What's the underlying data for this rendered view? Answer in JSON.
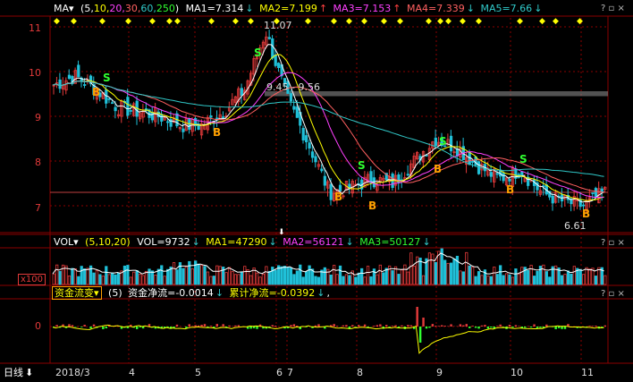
{
  "colors": {
    "up": "#e23a3a",
    "down": "#20c0d8",
    "ma1": "#ffffff",
    "ma2": "#ffff00",
    "ma3": "#ff40ff",
    "ma4": "#ff6060",
    "ma5": "#30c8c8",
    "grid": "#8b0000",
    "label_white": "#ffffff",
    "label_yellow": "#ffff00",
    "label_magenta": "#ff40ff",
    "label_green": "#30ff30",
    "label_cyan": "#30c8c8",
    "accent_orange": "#ffa000"
  },
  "header": {
    "indicator": "MA",
    "params_open": "(",
    "p1": "5,",
    "p2": "10,",
    "p3": "20,",
    "p4": "30,",
    "p5": "60,",
    "p6": "250",
    "params_close": ")",
    "ma1": "MA1=7.314",
    "ma1_arrow": "↓",
    "ma2": "MA2=7.199",
    "ma2_arrow": "↑",
    "ma3": "MA3=7.153",
    "ma3_arrow": "↑",
    "ma4": "MA4=7.339",
    "ma4_arrow": "↓",
    "ma5": "MA5=7.66",
    "ma5_arrow": "↓",
    "icons": "?",
    "close": "×"
  },
  "price_axis": {
    "labels": [
      "11",
      "10",
      "9",
      "8",
      "7"
    ],
    "min": 6.4,
    "max": 11.2
  },
  "annotations": {
    "high": "11.07",
    "low": "6.61",
    "range": "9.45 - 9.56",
    "buy": "B",
    "sell": "S"
  },
  "vol_header": {
    "indicator": "VOL",
    "params": "(5,10,20)",
    "vol": "VOL=9732",
    "vol_arrow": "↓",
    "ma1": "MA1=47290",
    "ma1_arrow": "↓",
    "ma2": "MA2=56121",
    "ma2_arrow": "↓",
    "ma3": "MA3=50127",
    "ma3_arrow": "↓",
    "unit": "x100"
  },
  "flow_header": {
    "indicator": "资金流变",
    "params": "(5)",
    "net": "资金净流=-0.0014",
    "net_arrow": "↓",
    "cum": "累计净流=-0.0392",
    "cum_arrow": "↓",
    "tail": ",",
    "zero": "0"
  },
  "footer": {
    "period": "日线",
    "period_arrow": "⬇",
    "months": [
      "2018/3",
      "4",
      "5",
      "6",
      "7",
      "8",
      "9",
      "10",
      "11"
    ]
  },
  "chart_data": {
    "type": "candlestick",
    "series_label": "price",
    "ylim": [
      6.4,
      11.2
    ],
    "close_points": [
      [
        "2018/3",
        9.7
      ],
      [
        "",
        9.9
      ],
      [
        "",
        9.6
      ],
      [
        "",
        9.2
      ],
      [
        "4",
        9.1
      ],
      [
        "",
        9.0
      ],
      [
        "",
        8.8
      ],
      [
        "5",
        8.8
      ],
      [
        "",
        9.1
      ],
      [
        "",
        9.6
      ],
      [
        "",
        10.9
      ],
      [
        "6",
        9.4
      ],
      [
        "",
        8.4
      ],
      [
        "7",
        7.3
      ],
      [
        "",
        7.4
      ],
      [
        "",
        7.6
      ],
      [
        "8",
        7.5
      ],
      [
        "",
        8.0
      ],
      [
        "",
        8.5
      ],
      [
        "9",
        8.3
      ],
      [
        "",
        7.9
      ],
      [
        "",
        7.6
      ],
      [
        "10",
        7.8
      ],
      [
        "",
        7.3
      ],
      [
        "",
        7.1
      ],
      [
        "11",
        7.0
      ],
      [
        "",
        7.3
      ]
    ]
  }
}
